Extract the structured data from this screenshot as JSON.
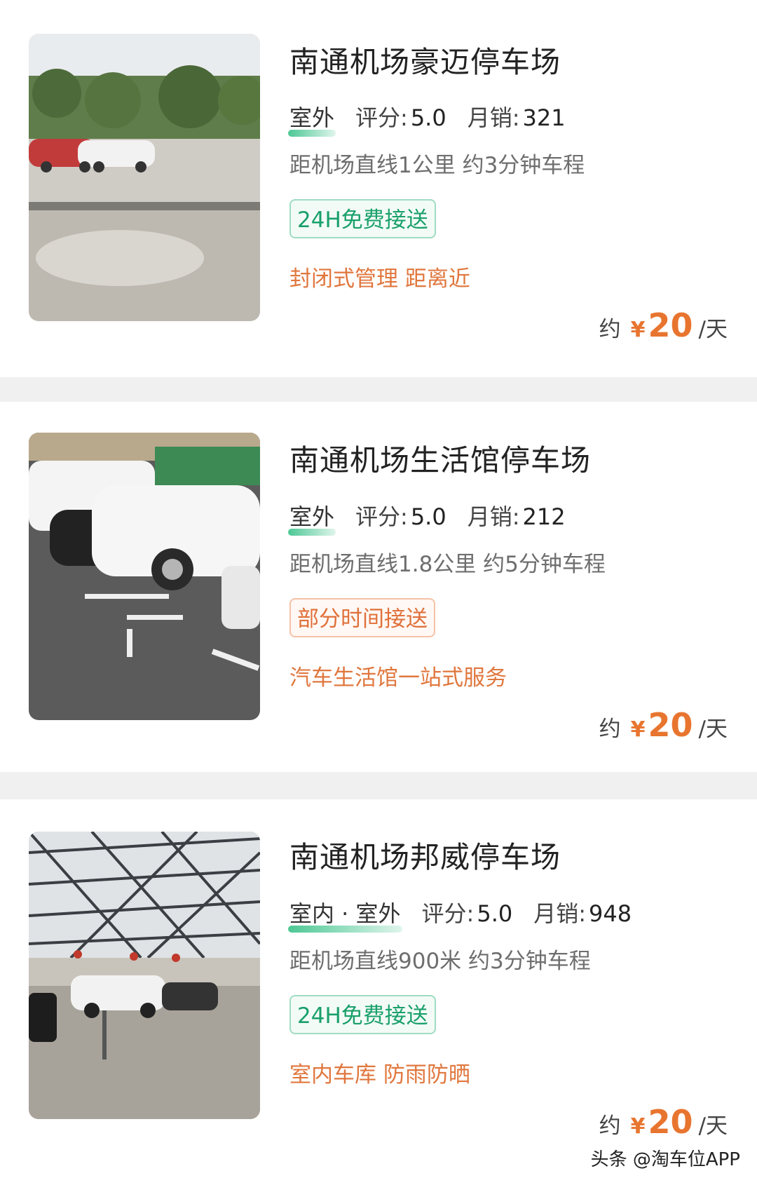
{
  "listings": [
    {
      "title": "南通机场豪迈停车场",
      "location_type": "室外",
      "rating_label": "评分:",
      "rating": "5.0",
      "sales_label": "月销:",
      "sales": "321",
      "distance": "距机场直线1公里 约3分钟车程",
      "badge": "24H免费接送",
      "feature": "封闭式管理 距离近",
      "price_prefix": "约",
      "currency": "¥",
      "price": "20",
      "price_unit": "/天"
    },
    {
      "title": "南通机场生活馆停车场",
      "location_type": "室外",
      "rating_label": "评分:",
      "rating": "5.0",
      "sales_label": "月销:",
      "sales": "212",
      "distance": "距机场直线1.8公里 约5分钟车程",
      "badge": "部分时间接送",
      "feature": "汽车生活馆一站式服务",
      "price_prefix": "约",
      "currency": "¥",
      "price": "20",
      "price_unit": "/天"
    },
    {
      "title": "南通机场邦威停车场",
      "location_type": "室内 · 室外",
      "rating_label": "评分:",
      "rating": "5.0",
      "sales_label": "月销:",
      "sales": "948",
      "distance": "距机场直线900米 约3分钟车程",
      "badge": "24H免费接送",
      "feature": "室内车库 防雨防晒",
      "price_prefix": "约",
      "currency": "¥",
      "price": "20",
      "price_unit": "/天"
    }
  ],
  "watermark": "头条 @淘车位APP",
  "colors": {
    "accent_orange": "#e8752f",
    "badge_green": "#1aa06a",
    "badge_orange": "#e0703a",
    "underline_green": "#2ebe82"
  }
}
